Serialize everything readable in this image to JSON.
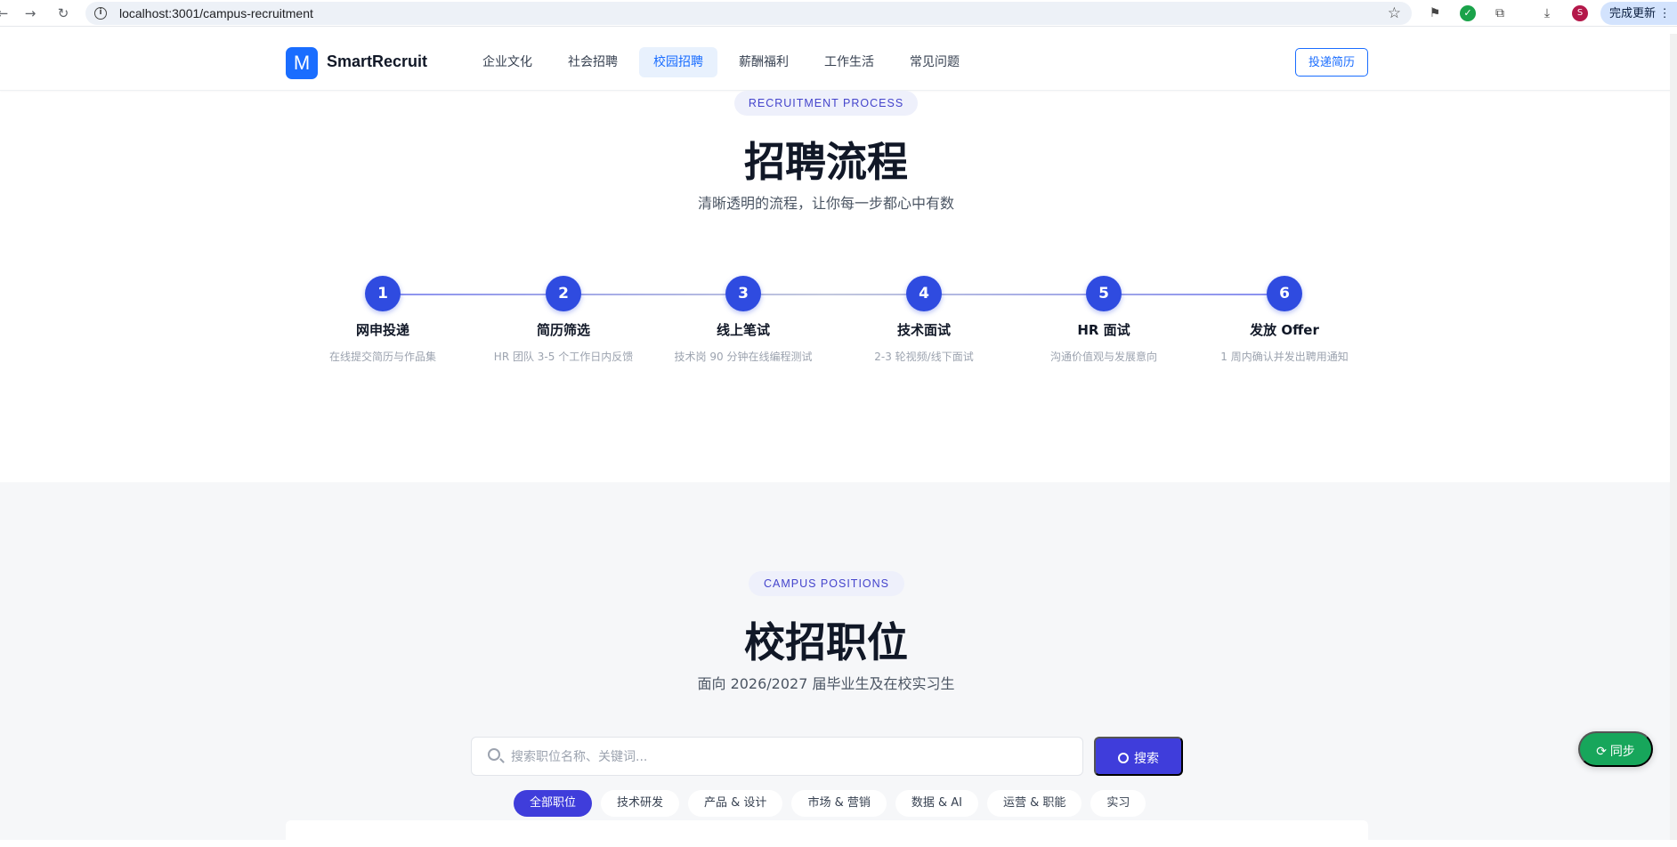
{
  "browser": {
    "url": "localhost:3001/campus-recruitment",
    "update_label": "完成更新",
    "avatar_letter": "S"
  },
  "header": {
    "brand": "SmartRecruit",
    "logo_letter": "M",
    "nav": [
      "企业文化",
      "社会招聘",
      "校园招聘",
      "薪酬福利",
      "工作生活",
      "常见问题"
    ],
    "active_nav": "校园招聘",
    "apply_label": "投递简历"
  },
  "process": {
    "eyebrow": "RECRUITMENT PROCESS",
    "title": "招聘流程",
    "subtitle": "清晰透明的流程，让你每一步都心中有数",
    "steps": [
      {
        "num": "1",
        "name": "网申投递",
        "desc": "在线提交简历与作品集"
      },
      {
        "num": "2",
        "name": "简历筛选",
        "desc": "HR 团队 3-5 个工作日内反馈"
      },
      {
        "num": "3",
        "name": "线上笔试",
        "desc": "技术岗 90 分钟在线编程测试"
      },
      {
        "num": "4",
        "name": "技术面试",
        "desc": "2-3 轮视频/线下面试"
      },
      {
        "num": "5",
        "name": "HR 面试",
        "desc": "沟通价值观与发展意向"
      },
      {
        "num": "6",
        "name": "发放 Offer",
        "desc": "1 周内确认并发出聘用通知"
      }
    ]
  },
  "positions": {
    "eyebrow": "CAMPUS POSITIONS",
    "title": "校招职位",
    "subtitle": "面向 2026/2027 届毕业生及在校实习生",
    "search_placeholder": "搜索职位名称、关键词...",
    "search_button": "搜索",
    "tabs": [
      "全部职位",
      "技术研发",
      "产品 & 设计",
      "市场 & 营销",
      "数据 & AI",
      "运营 & 职能",
      "实习"
    ],
    "active_tab": "全部职位"
  },
  "sync_label": "同步",
  "colors": {
    "primary": "#1a6dff",
    "step_circle": "#2f4be0",
    "search_button": "#3f3ddb",
    "sync": "#17a65b"
  }
}
